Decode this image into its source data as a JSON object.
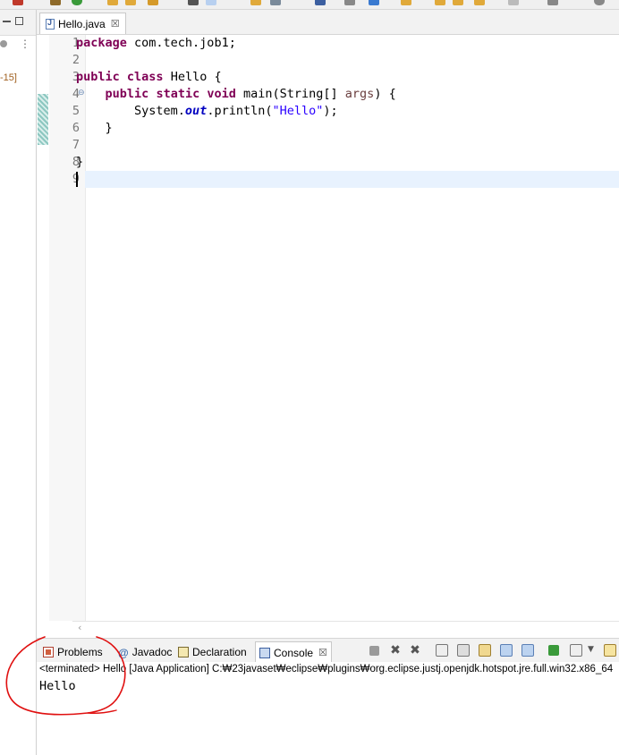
{
  "editor": {
    "tab_label": "Hello.java",
    "tab_close": "☒",
    "lines": [
      {
        "n": "1",
        "segments": [
          {
            "t": "package",
            "c": "kw"
          },
          {
            "t": " com.tech.job1;",
            "c": ""
          }
        ]
      },
      {
        "n": "2",
        "segments": []
      },
      {
        "n": "3",
        "segments": [
          {
            "t": "public",
            "c": "kw"
          },
          {
            "t": " ",
            "c": ""
          },
          {
            "t": "class",
            "c": "kw"
          },
          {
            "t": " Hello {",
            "c": ""
          }
        ]
      },
      {
        "n": "4",
        "segments": [
          {
            "t": "    ",
            "c": ""
          },
          {
            "t": "public",
            "c": "kw"
          },
          {
            "t": " ",
            "c": ""
          },
          {
            "t": "static",
            "c": "kw"
          },
          {
            "t": " ",
            "c": ""
          },
          {
            "t": "void",
            "c": "kw"
          },
          {
            "t": " main(String[] ",
            "c": ""
          },
          {
            "t": "args",
            "c": "arg"
          },
          {
            "t": ") {",
            "c": ""
          }
        ]
      },
      {
        "n": "5",
        "segments": [
          {
            "t": "        System.",
            "c": ""
          },
          {
            "t": "out",
            "c": "fld"
          },
          {
            "t": ".println(",
            "c": ""
          },
          {
            "t": "\"Hello\"",
            "c": "str"
          },
          {
            "t": ");",
            "c": ""
          }
        ]
      },
      {
        "n": "6",
        "segments": [
          {
            "t": "    }",
            "c": ""
          }
        ]
      },
      {
        "n": "7",
        "segments": []
      },
      {
        "n": "8",
        "segments": [
          {
            "t": "}",
            "c": ""
          }
        ]
      },
      {
        "n": "9",
        "segments": []
      }
    ],
    "fold_marker": "⊖"
  },
  "left_panel": {
    "label": "-15]"
  },
  "console": {
    "tabs": [
      {
        "label": "Problems",
        "icon": "problems-icon"
      },
      {
        "label": "Javadoc",
        "icon": "javadoc-icon"
      },
      {
        "label": "Declaration",
        "icon": "declaration-icon"
      },
      {
        "label": "Console",
        "icon": "console-icon",
        "active": true
      }
    ],
    "console_close": "☒",
    "status": "<terminated> Hello [Java Application] C:₩23javaset₩eclipse₩plugins₩org.eclipse.justj.openjdk.hotspot.jre.full.win32.x86_64",
    "output": "Hello"
  },
  "colors": {
    "annotation_circle": "#e01010"
  }
}
